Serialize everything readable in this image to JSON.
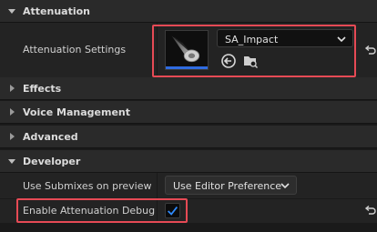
{
  "sections": {
    "attenuation": "Attenuation",
    "effects": "Effects",
    "voice_management": "Voice Management",
    "advanced": "Advanced",
    "developer": "Developer"
  },
  "attenuation_settings": {
    "label": "Attenuation Settings",
    "asset_value": "SA_Impact",
    "icons": [
      "speaker-cone-thumbnail-icon",
      "use-selected-asset-icon",
      "browse-to-asset-icon",
      "chevron-down-icon",
      "reset-to-default-icon"
    ]
  },
  "developer": {
    "use_submixes_label": "Use Submixes on preview",
    "use_submixes_value": "Use Editor Preference",
    "enable_attenuation_debug_label": "Enable Attenuation Debug",
    "enable_attenuation_debug_checked": true
  },
  "colors": {
    "highlight": "#e64a55",
    "checkbox_accent": "#2f8bff",
    "thumbnail_bar": "#2f6be0"
  }
}
